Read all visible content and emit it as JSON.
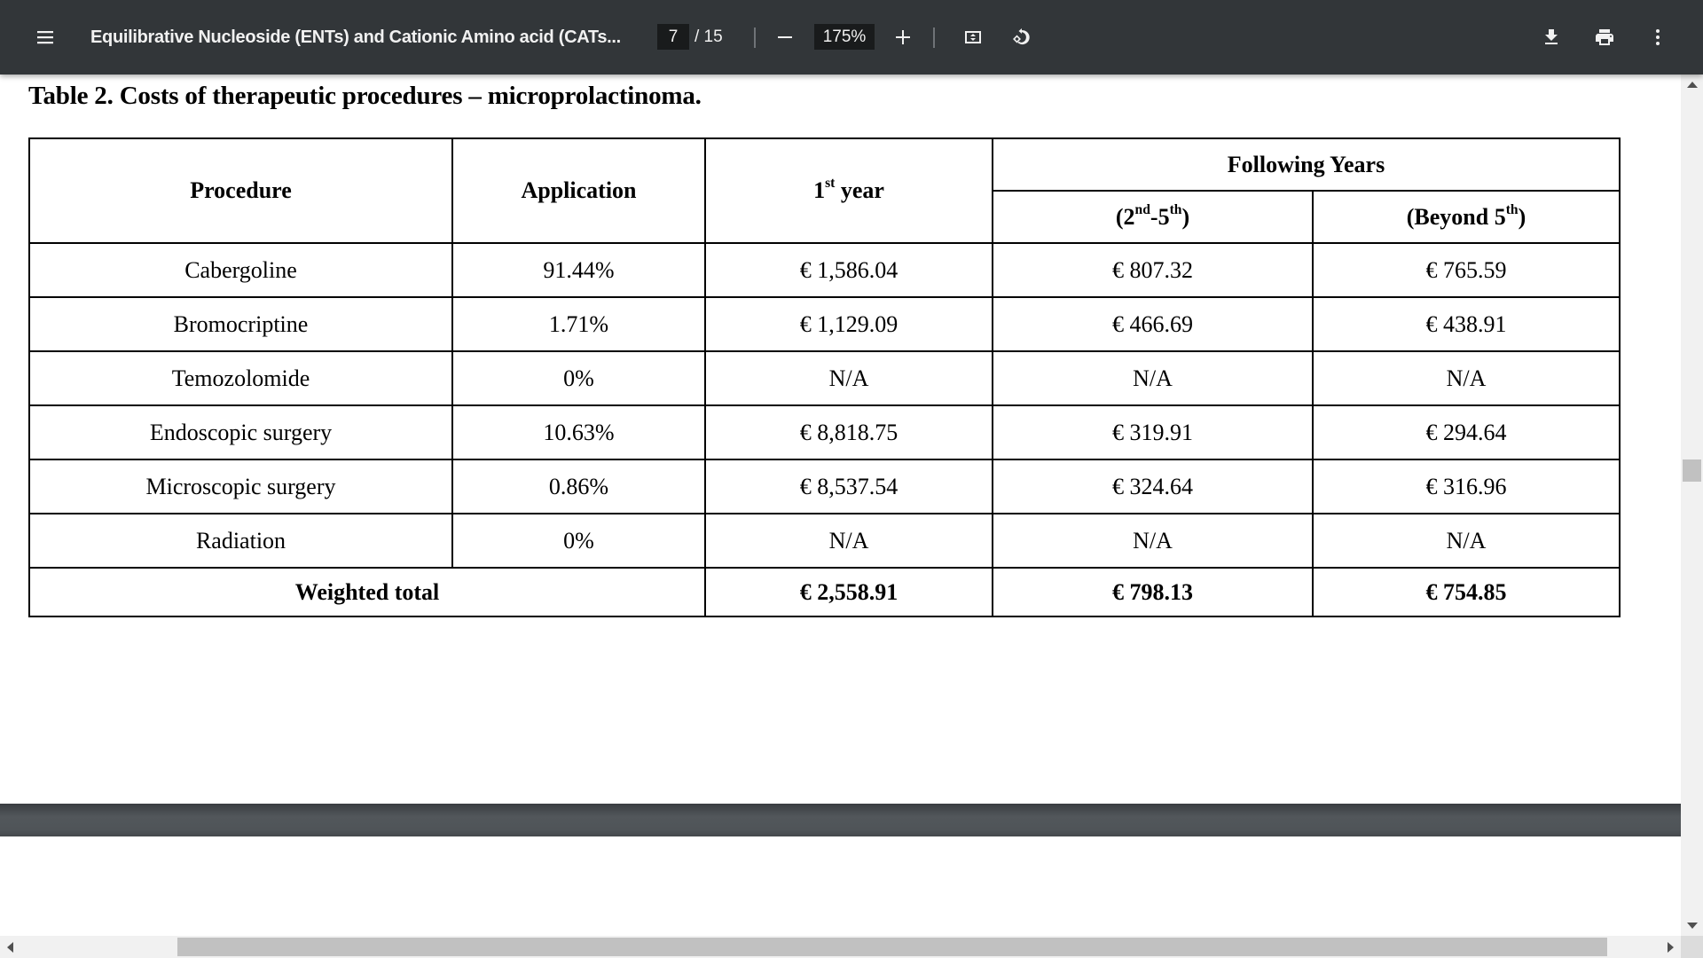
{
  "toolbar": {
    "menu_icon": "hamburger-menu-icon",
    "title": "Equilibrative Nucleoside (ENTs) and Cationic Amino acid (CATs...",
    "current_page": "7",
    "page_total": "/ 15",
    "zoom_out_icon": "minus-icon",
    "zoom_level": "175%",
    "zoom_in_icon": "plus-icon",
    "fit_icon": "fit-to-page-icon",
    "rotate_icon": "rotate-counterclockwise-icon",
    "download_icon": "download-icon",
    "print_icon": "print-icon",
    "more_icon": "more-vert-icon"
  },
  "document": {
    "table_title": "Table 2. Costs of therapeutic procedures – microprolactinoma.",
    "headers": {
      "procedure": "Procedure",
      "application": "Application",
      "first_year": {
        "base": "1",
        "sup": "st",
        "rest": " year"
      },
      "following_years": "Following Years",
      "years_2_5": {
        "open": "(2",
        "sup1": "nd",
        "mid": "-5",
        "sup2": "th",
        "close": ")"
      },
      "beyond_5": {
        "open": "(Beyond 5",
        "sup": "th",
        "close": ")"
      }
    },
    "rows": [
      {
        "procedure": "Cabergoline",
        "application": "91.44%",
        "first_year": "€ 1,586.04",
        "years_2_5": "€ 807.32",
        "beyond_5": "€ 765.59"
      },
      {
        "procedure": "Bromocriptine",
        "application": "1.71%",
        "first_year": "€ 1,129.09",
        "years_2_5": "€ 466.69",
        "beyond_5": "€ 438.91"
      },
      {
        "procedure": "Temozolomide",
        "application": "0%",
        "first_year": "N/A",
        "years_2_5": "N/A",
        "beyond_5": "N/A"
      },
      {
        "procedure": "Endoscopic surgery",
        "application": "10.63%",
        "first_year": "€ 8,818.75",
        "years_2_5": "€ 319.91",
        "beyond_5": "€ 294.64"
      },
      {
        "procedure": "Microscopic surgery",
        "application": "0.86%",
        "first_year": "€ 8,537.54",
        "years_2_5": "€ 324.64",
        "beyond_5": "€ 316.96"
      },
      {
        "procedure": "Radiation",
        "application": "0%",
        "first_year": "N/A",
        "years_2_5": "N/A",
        "beyond_5": "N/A"
      }
    ],
    "total": {
      "label": "Weighted total",
      "first_year": "€ 2,558.91",
      "years_2_5": "€ 798.13",
      "beyond_5": "€ 754.85"
    }
  },
  "colors": {
    "toolbar_bg": "#323639",
    "toolbar_text": "#f1f1f1",
    "input_bg": "#191b1c",
    "page_gap": "#4f5458",
    "scrollbar_track": "#f1f1f1",
    "scrollbar_thumb": "#c1c1c1"
  }
}
